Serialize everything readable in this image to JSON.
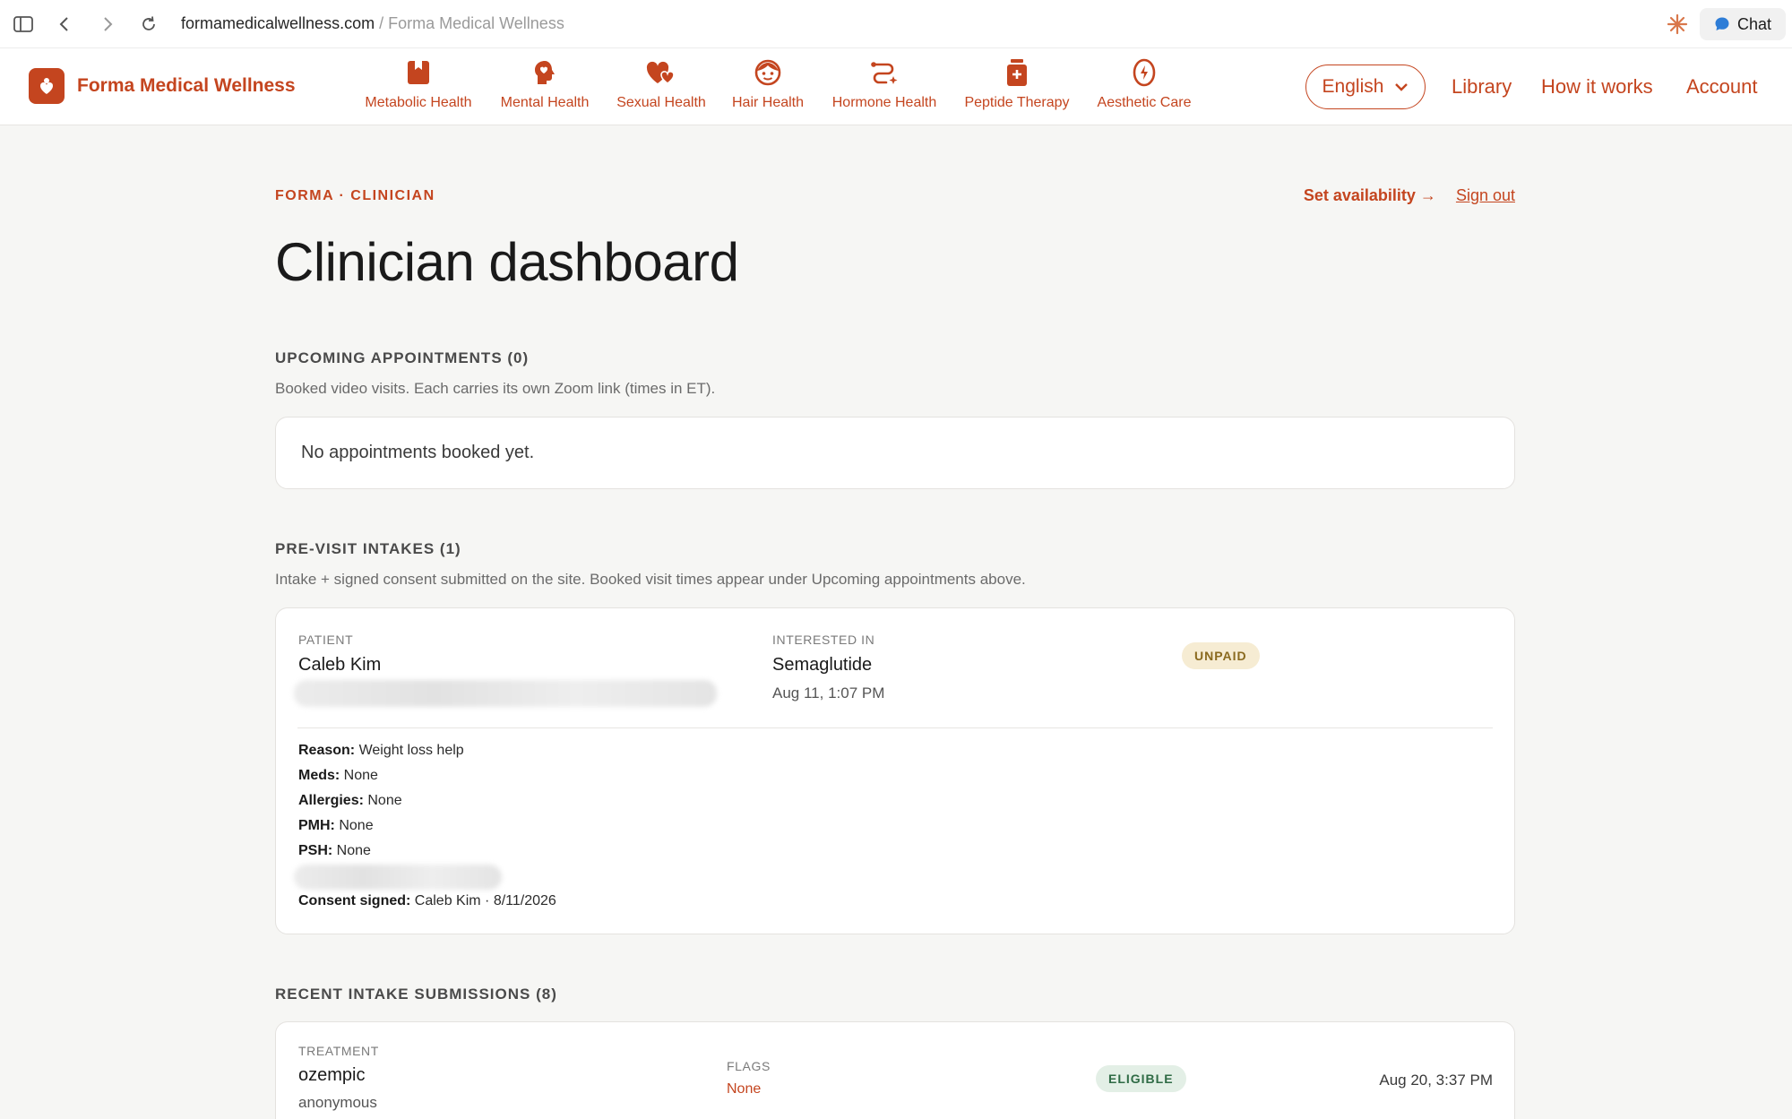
{
  "browser": {
    "domain": "formamedicalwellness.com",
    "separator": " / ",
    "page_title": "Forma Medical Wellness",
    "chat_label": "Chat"
  },
  "header": {
    "brand": "Forma Medical Wellness",
    "nav": [
      {
        "label": "Metabolic Health",
        "icon": "metabolic-icon"
      },
      {
        "label": "Mental Health",
        "icon": "head-heart-icon"
      },
      {
        "label": "Sexual Health",
        "icon": "hearts-icon"
      },
      {
        "label": "Hair Health",
        "icon": "face-icon"
      },
      {
        "label": "Hormone Health",
        "icon": "hormone-path-icon"
      },
      {
        "label": "Peptide Therapy",
        "icon": "vial-icon"
      },
      {
        "label": "Aesthetic Care",
        "icon": "aesthetic-icon"
      }
    ],
    "language": "English",
    "links": {
      "library": "Library",
      "how": "How it works",
      "account": "Account"
    },
    "accent": "#c4451f"
  },
  "dashboard": {
    "eyebrow": "FORMA · CLINICIAN",
    "set_availability": "Set availability →",
    "sign_out": "Sign out",
    "title": "Clinician dashboard",
    "upcoming": {
      "title": "UPCOMING APPOINTMENTS (0)",
      "subtitle": "Booked video visits. Each carries its own Zoom link (times in ET).",
      "empty": "No appointments booked yet."
    },
    "intakes": {
      "title": "PRE-VISIT INTAKES (1)",
      "subtitle": "Intake + signed consent submitted on the site. Booked visit times appear under Upcoming appointments above.",
      "item": {
        "patient_label": "PATIENT",
        "patient": "Caleb Kim",
        "interest_label": "INTERESTED IN",
        "interest": "Semaglutide",
        "date": "Aug 11, 1:07 PM",
        "status": "UNPAID",
        "reason_k": "Reason:",
        "reason_v": " Weight loss help",
        "meds_k": "Meds:",
        "meds_v": " None",
        "allergies_k": "Allergies:",
        "allergies_v": " None",
        "pmh_k": "PMH:",
        "pmh_v": " None",
        "psh_k": "PSH:",
        "psh_v": " None",
        "consent_k": "Consent signed:",
        "consent_v": " Caleb Kim · 8/11/2026"
      }
    },
    "recent": {
      "title": "RECENT INTAKE SUBMISSIONS (8)",
      "item": {
        "treatment_label": "TREATMENT",
        "treatment": "ozempic",
        "patient": "anonymous",
        "flags_label": "FLAGS",
        "flags": "None",
        "status": "ELIGIBLE",
        "time": "Aug 20, 3:37 PM"
      }
    }
  }
}
